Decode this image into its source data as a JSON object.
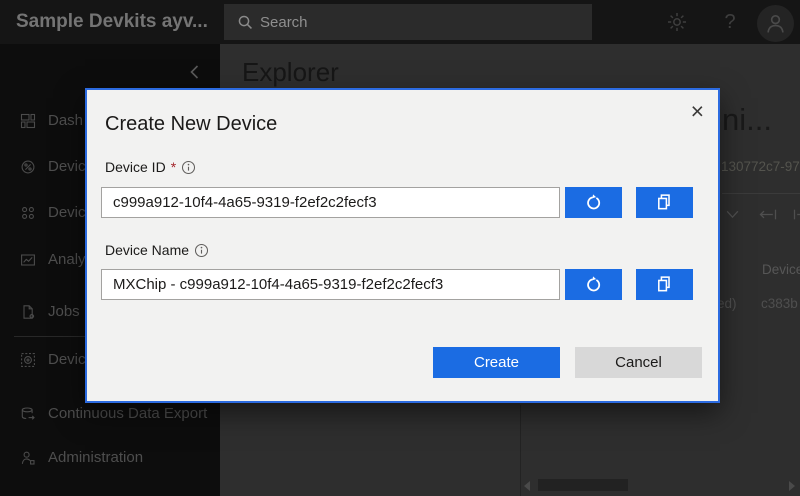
{
  "topbar": {
    "app_title": "Sample Devkits ayv...",
    "search_placeholder": "Search"
  },
  "sidebar": {
    "items": [
      {
        "label": "Dash"
      },
      {
        "label": "Devic"
      },
      {
        "label": "Devic"
      },
      {
        "label": "Analy"
      },
      {
        "label": "Jobs"
      },
      {
        "label": "Devic"
      },
      {
        "label": "Continuous Data Export"
      },
      {
        "label": "Administration"
      }
    ]
  },
  "main": {
    "page_title": "Explorer",
    "detail_title": "ni...",
    "detail_id": "130772c7-97",
    "table": {
      "header": "Device",
      "row_fragment": "ed)",
      "row_device_id": "c383b"
    }
  },
  "modal": {
    "title": "Create New Device",
    "close_label": "×",
    "device_id_label": "Device ID",
    "required_marker": "*",
    "device_id_value": "c999a912-10f4-4a65-9319-f2ef2c2fecf3",
    "device_name_label": "Device Name",
    "device_name_value": "MXChip - c999a912-10f4-4a65-9319-f2ef2c2fecf3",
    "create_label": "Create",
    "cancel_label": "Cancel"
  },
  "colors": {
    "accent": "#1b6ce3",
    "modal_border": "#2c6be0",
    "error": "#a4262c",
    "modal_bg": "#f2f2f1"
  }
}
